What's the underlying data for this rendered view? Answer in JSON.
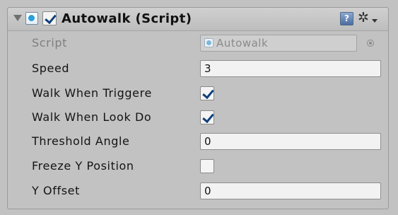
{
  "component": {
    "title": "Autowalk (Script)",
    "icons": {
      "foldout": "triangle-down-icon",
      "component": "script-icon",
      "help": "help-book-icon",
      "settings": "gear-icon"
    },
    "enabled": true,
    "help_glyph": "?",
    "gear_glyph": "✲"
  },
  "fields": {
    "script": {
      "label": "Script",
      "value": "Autowalk"
    },
    "speed": {
      "label": "Speed",
      "value": "3"
    },
    "walk_when_triggered": {
      "label": "Walk When Triggere",
      "checked": true
    },
    "walk_when_look_down": {
      "label": "Walk When Look Do",
      "checked": true
    },
    "threshold_angle": {
      "label": "Threshold Angle",
      "value": "0"
    },
    "freeze_y_position": {
      "label": "Freeze Y Position",
      "checked": false
    },
    "y_offset": {
      "label": "Y Offset",
      "value": "0"
    }
  },
  "colors": {
    "panel_bg": "#c2c2c2",
    "check_color": "#0e3f7a",
    "disabled_text": "#7e7e7e"
  }
}
